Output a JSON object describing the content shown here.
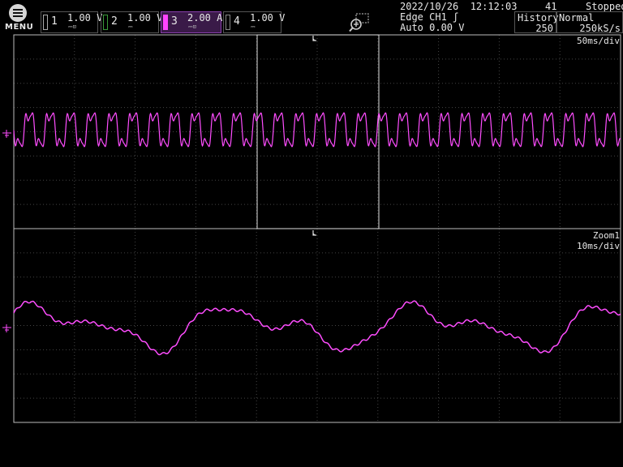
{
  "menu": {
    "label": "MENU"
  },
  "channels": [
    {
      "number": "1",
      "scale": "1.00 V",
      "coupling": "DC"
    },
    {
      "number": "2",
      "scale": "1.00 V",
      "coupling": "DC"
    },
    {
      "number": "3",
      "scale": "2.00 A",
      "coupling": "DC"
    },
    {
      "number": "4",
      "scale": "1.00 V",
      "coupling": "DC"
    }
  ],
  "header": {
    "datetime": "2022/10/26  12:12:03",
    "acq_count": "41",
    "status": "Stopped",
    "trigger_type": "Edge CH1 ʃ",
    "trigger_mode": "Auto 0.00 V",
    "history_label": "History",
    "history_value": "250",
    "mode_label": "Normal",
    "sample_rate": "250kS/s"
  },
  "main_view": {
    "time_div": "50ms/div"
  },
  "zoom_view": {
    "label": "Zoom1",
    "time_div": "10ms/div"
  },
  "colors": {
    "trace": "#ff4dff",
    "grid": "#3a3a3a",
    "frame": "#bdbdbd",
    "ch3_badge": "#8a3fae"
  },
  "icons": {
    "zoom": "zoom-magnifier-icon",
    "menu": "menu-icon",
    "trigger": "trigger-marker-icon",
    "ground": "ground-marker-icon"
  }
}
